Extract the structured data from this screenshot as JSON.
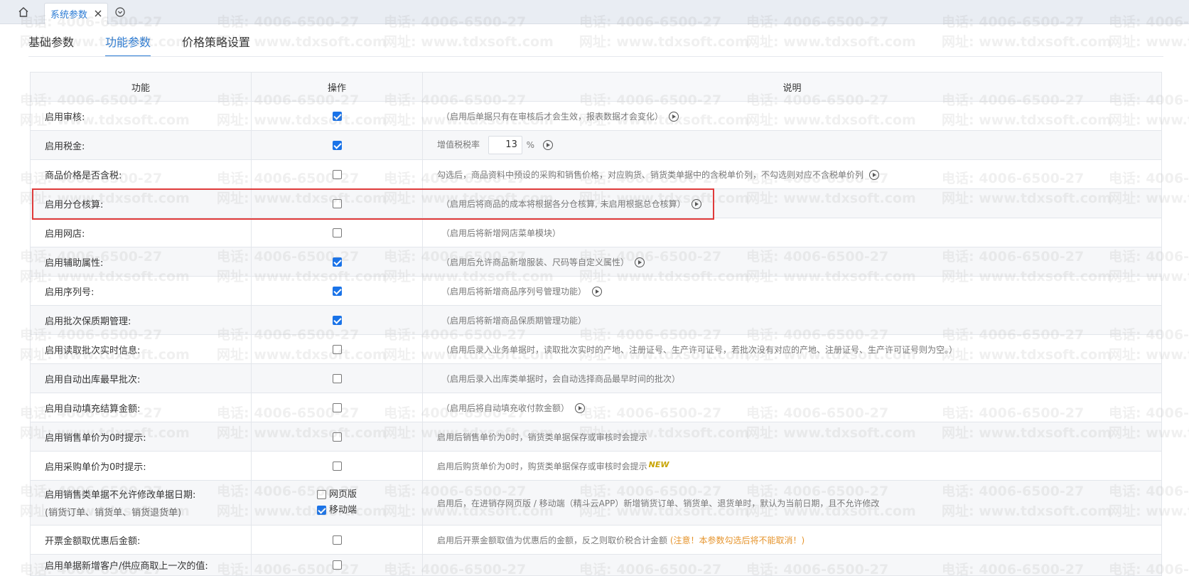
{
  "topbar": {
    "home_icon": "home-icon",
    "active_tab": "系统参数",
    "close_icon": "close-icon",
    "dropdown_icon": "chevron-down-circle-icon"
  },
  "subtabs": [
    {
      "label": "基础参数",
      "active": false
    },
    {
      "label": "功能参数",
      "active": true
    },
    {
      "label": "价格策略设置",
      "active": false
    }
  ],
  "table": {
    "headers": {
      "func": "功能",
      "op": "操作",
      "desc": "说明"
    },
    "rows": [
      {
        "func": "启用审核:",
        "checked": true,
        "desc": "（启用后单据只有在审核后才会生效，报表数据才会变化）",
        "play": true
      },
      {
        "func": "启用税金:",
        "checked": true,
        "desc_label": "增值税税率",
        "tax_value": "13",
        "tax_unit": "%",
        "play": true
      },
      {
        "func": "商品价格是否含税:",
        "checked": false,
        "desc": "勾选后，商品资料中预设的采购和销售价格，对应购货、销货类单据中的含税单价列，不勾选则对应不含税单价列",
        "play": true
      },
      {
        "func": "启用分仓核算:",
        "checked": false,
        "desc": "（启用后将商品的成本将根据各分仓核算, 未启用根据总仓核算）",
        "play": true
      },
      {
        "func": "启用网店:",
        "checked": false,
        "desc": "（启用后将新增网店菜单模块）",
        "play": false
      },
      {
        "func": "启用辅助属性:",
        "checked": true,
        "desc": "（启用后允许商品新增服装、尺码等自定义属性）",
        "play": true
      },
      {
        "func": "启用序列号:",
        "checked": true,
        "desc": "（启用后将新增商品序列号管理功能）",
        "play": true
      },
      {
        "func": "启用批次保质期管理:",
        "checked": true,
        "desc": "（启用后将新增商品保质期管理功能）",
        "play": false
      },
      {
        "func": "启用读取批次实时信息:",
        "checked": false,
        "desc": "（启用后录入业务单据时，读取批次实时的产地、注册证号、生产许可证号，若批次没有对应的产地、注册证号、生产许可证号则为空。）",
        "play": false
      },
      {
        "func": "启用自动出库最早批次:",
        "checked": false,
        "desc": "（启用后录入出库类单据时，会自动选择商品最早时间的批次）",
        "play": false
      },
      {
        "func": "启用自动填充结算金额:",
        "checked": false,
        "desc": "（启用后将自动填充收付款金额）",
        "play": true
      },
      {
        "func": "启用销售单价为0时提示:",
        "checked": false,
        "desc": "启用后销售单价为0时，销货类单据保存或审核时会提示",
        "play": false
      },
      {
        "func": "启用采购单价为0时提示:",
        "checked": false,
        "desc": "启用后购货单价为0时，购货类单据保存或审核时会提示",
        "badge": "NEW",
        "play": false
      },
      {
        "func": "启用销售类单据不允许修改单据日期:",
        "func_sub": "(销货订单、销货单、销货退货单)",
        "options": [
          {
            "label": "网页版",
            "checked": false
          },
          {
            "label": "移动端",
            "checked": true
          }
        ],
        "desc": "启用后，在进销存网页版 / 移动端（精斗云APP）新增销货订单、销货单、退货单时，默认为当前日期，且不允许修改"
      },
      {
        "func": "开票金额取优惠后金额:",
        "checked": false,
        "desc": "启用后开票金额取值为优惠后的金额，反之则取价税合计金额",
        "warn": "(注意！本参数勾选后将不能取消！)"
      },
      {
        "func": "启用单据新增客户/供应商取上一次的值:",
        "checked": false,
        "desc": ""
      }
    ]
  },
  "watermark": {
    "phone": "电话: 4006-6500-27",
    "site": "网址: www.tdxsoft.com"
  },
  "colors": {
    "accent": "#2b7bd4",
    "checkbox": "#1a73e8",
    "highlight": "#e03a3a",
    "warning": "#e6952e"
  }
}
